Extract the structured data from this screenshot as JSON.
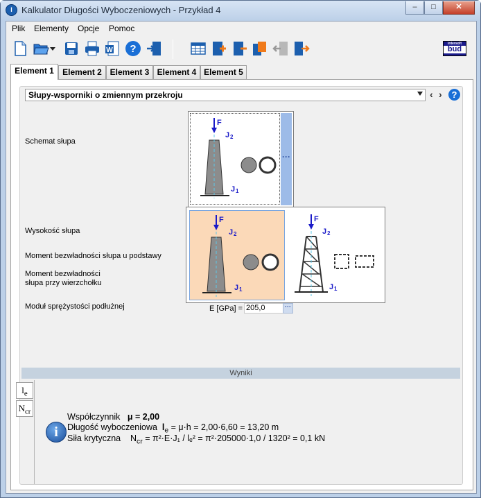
{
  "window": {
    "title": "Kalkulator Długości Wyboczeniowych - Przykład 4",
    "app_icon": "l",
    "controls": {
      "minimize": "–",
      "maximize": "□",
      "close": "✕"
    }
  },
  "menu": [
    "Plik",
    "Elementy",
    "Opcje",
    "Pomoc"
  ],
  "toolbar": {
    "icons": [
      "new-file-icon",
      "open-folder-icon",
      "save-icon",
      "print-icon",
      "export-word-icon",
      "help-icon",
      "exit-icon",
      "table-icon",
      "add-element-icon",
      "remove-element-icon",
      "copy-element-icon",
      "back-icon",
      "forward-icon"
    ],
    "logo_top": "intersoft",
    "logo_mid": "bud"
  },
  "tabs": [
    "Element 1",
    "Element 2",
    "Element 3",
    "Element 4",
    "Element 5"
  ],
  "active_tab": 0,
  "section": {
    "type_select": "Słupy-wsporniki o zmiennym przekroju",
    "prev": "‹",
    "next": "›",
    "help": "?"
  },
  "form": {
    "schemat_label": "Schemat słupa",
    "wysokosc_label": "Wysokość słupa",
    "moment_podstawa_label": "Moment bezwładności słupa u podstawy",
    "moment_wierzcholek_label_1": "Moment bezwładności",
    "moment_wierzcholek_label_2": "słupa przy wierzchołku",
    "modul_label": "Moduł sprężystości podłużnej",
    "modul_unit": "E [GPa] =",
    "modul_value": "205,0",
    "more_btn": "···"
  },
  "diagram": {
    "force": "F",
    "j2": "J",
    "j2_sub": "2",
    "j1": "J",
    "j1_sub": "1"
  },
  "results": {
    "header": "Wyniki",
    "side_tabs": [
      {
        "main": "l",
        "sub": "e"
      },
      {
        "main": "N",
        "sub": "cr"
      }
    ],
    "line1_label": "Współczynnik",
    "line1_value": "μ = 2,00",
    "line2_label": "Długość wyboczeniowa",
    "line2_sym": "l",
    "line2_sub": "e",
    "line2_value": " = μ·h = 2,00·6,60 = 13,20 m",
    "line3_label": "Siła krytyczna",
    "line3_sym": "N",
    "line3_sub": "cr",
    "line3_value": "= π²·E·J₁ / lₑ² = π²·205000·1,0 / 1320² = 0,1 kN"
  },
  "colors": {
    "accent": "#1a6fd6",
    "selected_option": "#fbd9b8",
    "results_bar": "#c5d2df",
    "diagram_blue": "#1a1ac8"
  }
}
